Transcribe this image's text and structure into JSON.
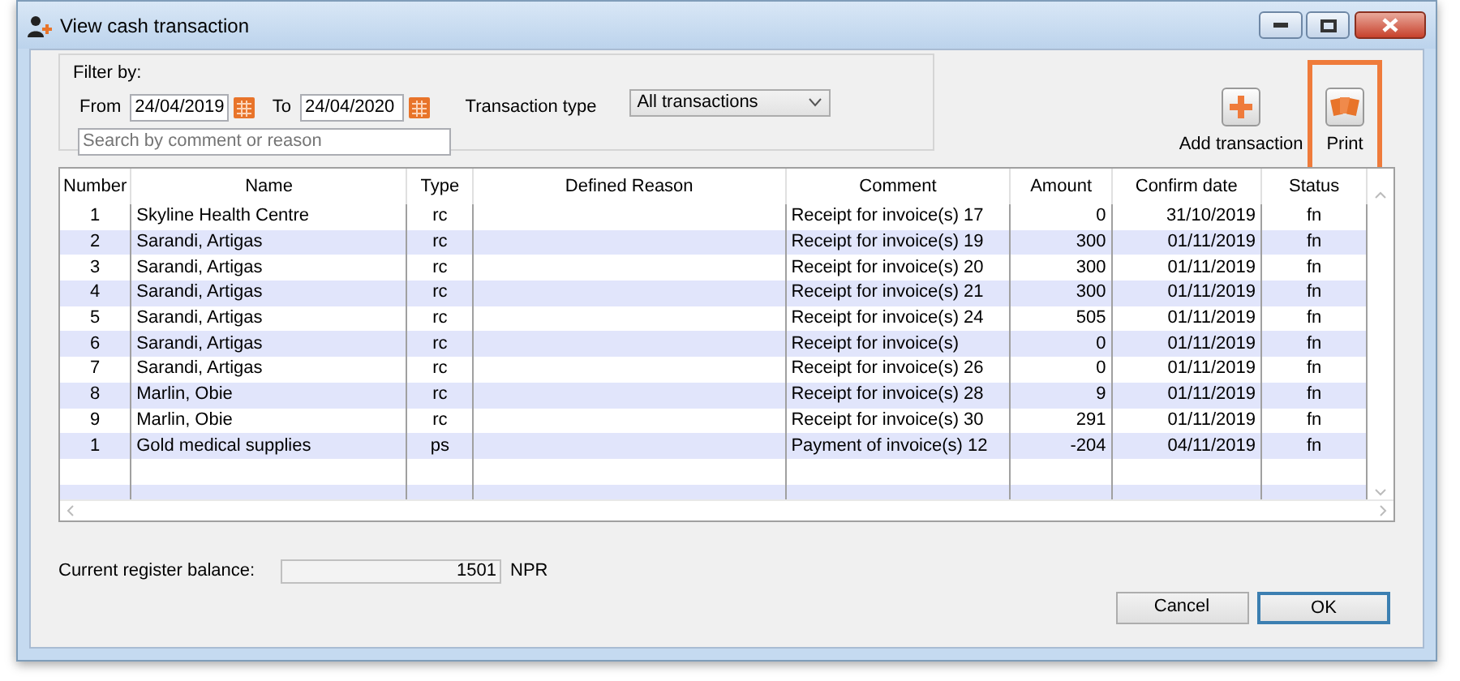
{
  "window": {
    "title": "View cash transaction"
  },
  "filter": {
    "legend": "Filter by:",
    "from_label": "From",
    "from_value": "24/04/2019",
    "to_label": "To",
    "to_value": "24/04/2020",
    "type_label": "Transaction type",
    "type_value": "All transactions",
    "search_placeholder": "Search by comment or reason"
  },
  "toolbar": [
    {
      "label": "Add transaction",
      "kind": "add",
      "highlighted": false
    },
    {
      "label": "Print",
      "kind": "print",
      "highlighted": true
    }
  ],
  "table": {
    "columns": [
      "Number",
      "Name",
      "Type",
      "Defined Reason",
      "Comment",
      "Amount",
      "Confirm date",
      "Status"
    ],
    "rows": [
      {
        "number": "1",
        "name": "Skyline Health Centre",
        "type": "rc",
        "comment": "Receipt for invoice(s) 17",
        "amount": "0",
        "confirm_date": "31/10/2019",
        "status": "fn"
      },
      {
        "number": "2",
        "name": "Sarandi, Artigas",
        "type": "rc",
        "comment": "Receipt for invoice(s) 19",
        "amount": "300",
        "confirm_date": "01/11/2019",
        "status": "fn"
      },
      {
        "number": "3",
        "name": "Sarandi, Artigas",
        "type": "rc",
        "comment": "Receipt for invoice(s) 20",
        "amount": "300",
        "confirm_date": "01/11/2019",
        "status": "fn"
      },
      {
        "number": "4",
        "name": "Sarandi, Artigas",
        "type": "rc",
        "comment": "Receipt for invoice(s) 21",
        "amount": "300",
        "confirm_date": "01/11/2019",
        "status": "fn"
      },
      {
        "number": "5",
        "name": "Sarandi, Artigas",
        "type": "rc",
        "comment": "Receipt for invoice(s) 24",
        "amount": "505",
        "confirm_date": "01/11/2019",
        "status": "fn"
      },
      {
        "number": "6",
        "name": "Sarandi, Artigas",
        "type": "rc",
        "comment": "Receipt for invoice(s)",
        "amount": "0",
        "confirm_date": "01/11/2019",
        "status": "fn"
      },
      {
        "number": "7",
        "name": "Sarandi, Artigas",
        "type": "rc",
        "comment": "Receipt for invoice(s) 26",
        "amount": "0",
        "confirm_date": "01/11/2019",
        "status": "fn"
      },
      {
        "number": "8",
        "name": "Marlin, Obie",
        "type": "rc",
        "comment": "Receipt for invoice(s) 28",
        "amount": "9",
        "confirm_date": "01/11/2019",
        "status": "fn"
      },
      {
        "number": "9",
        "name": "Marlin, Obie",
        "type": "rc",
        "comment": "Receipt for invoice(s) 30",
        "amount": "291",
        "confirm_date": "01/11/2019",
        "status": "fn"
      },
      {
        "number": "1",
        "name": "Gold medical supplies",
        "type": "ps",
        "comment": "Payment of invoice(s) 12",
        "amount": "-204",
        "confirm_date": "04/11/2019",
        "status": "fn"
      }
    ]
  },
  "balance": {
    "label": "Current register balance:",
    "value": "1501",
    "currency": "NPR"
  },
  "buttons": [
    {
      "label": "Cancel",
      "default": false
    },
    {
      "label": "OK",
      "default": true
    }
  ]
}
